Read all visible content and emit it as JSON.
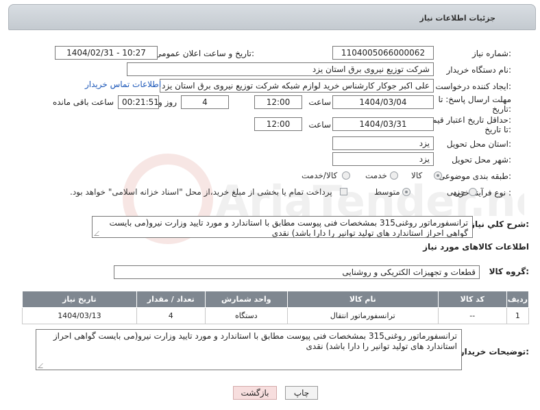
{
  "header": {
    "title": "جزئیات اطلاعات نیاز"
  },
  "fields": {
    "need_number_label": "شماره نیاز:",
    "need_number": "1104005066000062",
    "announce_label": "تاریخ و ساعت اعلان عمومی:",
    "announce_value": "1404/02/31 - 10:27",
    "buyer_org_label": "نام دستگاه خریدار:",
    "buyer_org": "شرکت توزیع نیروی برق استان یزد",
    "creator_label": "ایجاد کننده درخواست:",
    "creator": "علی اکبر  جوکار  کارشناس خرید لوازم شبکه  شرکت توزیع نیروی برق استان یزد",
    "contact_link": "اطلاعات تماس خریدار",
    "deadline_label_1": "مهلت ارسال پاسخ: تا",
    "deadline_label_2": "تاریخ:",
    "deadline_date": "1404/03/04",
    "time_label": "ساعت",
    "deadline_time": "12:00",
    "days_value": "4",
    "days_label": "روز و",
    "remaining_value": "00:21:51",
    "remaining_label": "ساعت باقی مانده",
    "validity_label_1": "حداقل تاریخ اعتبار قیمت:",
    "validity_label_2": "تا تاریخ:",
    "validity_date": "1404/03/31",
    "validity_time": "12:00",
    "province_label": "استان محل تحویل:",
    "province": "یزد",
    "city_label": "شهر محل تحویل:",
    "city": "یزد",
    "category_label": "طبقه بندی موضوعی:",
    "category_options": [
      "کالا",
      "خدمت",
      "کالا/خدمت"
    ],
    "process_label": "نوع فرآیند خرید :",
    "process_options": [
      "جزیی",
      "متوسط"
    ],
    "payment_note": "پرداخت تمام یا بخشی از مبلغ خرید،از محل \"اسناد خزانه اسلامی\" خواهد بود.",
    "description_label": "شرح كلي نياز:",
    "description": "ترانسفورماتور روغنی315 بمشخصات فنی پیوست مطابق با استاندارد و مورد تایید وزارت نیرو(می بایست گواهی احراز استاندارد های تولید توانیر را دارا باشد) نقدی"
  },
  "goods": {
    "section_title": "اطلاعات کالاهای مورد نیاز",
    "group_label": "گروه کالا:",
    "group_value": "قطعات و تجهیزات الکتریکی و روشنایی",
    "columns": [
      "ردیف",
      "کد کالا",
      "نام کالا",
      "واحد شمارش",
      "تعداد / مقدار",
      "تاریخ نیاز"
    ],
    "rows": [
      [
        "1",
        "--",
        "ترانسفورماتور انتقال",
        "دستگاه",
        "4",
        "1404/03/13"
      ]
    ],
    "buyer_notes_label": "توضیحات خریدار:",
    "buyer_notes": "ترانسفورماتور روغنی315 بمشخصات فنی پیوست مطابق با استاندارد و مورد تایید وزارت نیرو(می بایست گواهی احراز استاندارد های تولید توانیر را دارا باشد) نقدی"
  },
  "buttons": {
    "print": "چاپ",
    "back": "بازگشت"
  },
  "watermark": {
    "text": "AriaTender.net"
  }
}
